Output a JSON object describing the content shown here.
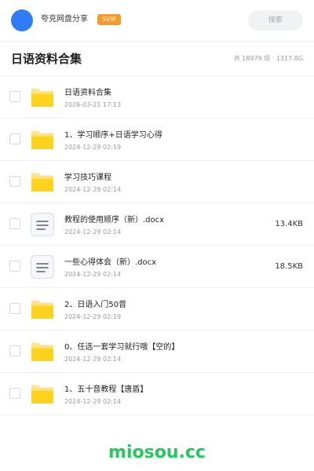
{
  "header": {
    "username": "夸克网盘分享",
    "badge": "SVIP",
    "search_label": "搜索"
  },
  "folder": {
    "title": "日语资料合集",
    "summary": "共 18979 项 · 1317.8G"
  },
  "files": [
    {
      "type": "folder",
      "icon": "folder-icon",
      "name": "日语资料合集",
      "date": "2026-03-21 17:13",
      "size": ""
    },
    {
      "type": "folder",
      "icon": "folder-icon",
      "name": "1、学习顺序+日语学习心得",
      "date": "2024-12-29 02:19",
      "size": ""
    },
    {
      "type": "folder",
      "icon": "folder-icon",
      "name": "学习技巧课程",
      "date": "2024-12-29 02:14",
      "size": ""
    },
    {
      "type": "document",
      "icon": "document-icon",
      "name": "教程的使用顺序（新）.docx",
      "date": "2024-12-29 02:14",
      "size": "13.4KB"
    },
    {
      "type": "document",
      "icon": "document-icon",
      "name": "一些心得体会（新）.docx",
      "date": "2024-12-29 02:14",
      "size": "18.5KB"
    },
    {
      "type": "folder",
      "icon": "folder-icon",
      "name": "2、日语入门50音",
      "date": "2024-12-29 02:19",
      "size": ""
    },
    {
      "type": "folder",
      "icon": "folder-icon",
      "name": "0、任选一套学习就行哦【空的】",
      "date": "2024-12-29 02:14",
      "size": ""
    },
    {
      "type": "folder",
      "icon": "folder-icon",
      "name": "1、五十音教程【唐盾】",
      "date": "2024-12-29 02:14",
      "size": ""
    }
  ],
  "watermark": "miosou.cc",
  "colors": {
    "accent": "#2f7cf6",
    "svip": "#f79a2c",
    "folder": "#ffd21f",
    "watermark": "#24c95d"
  }
}
